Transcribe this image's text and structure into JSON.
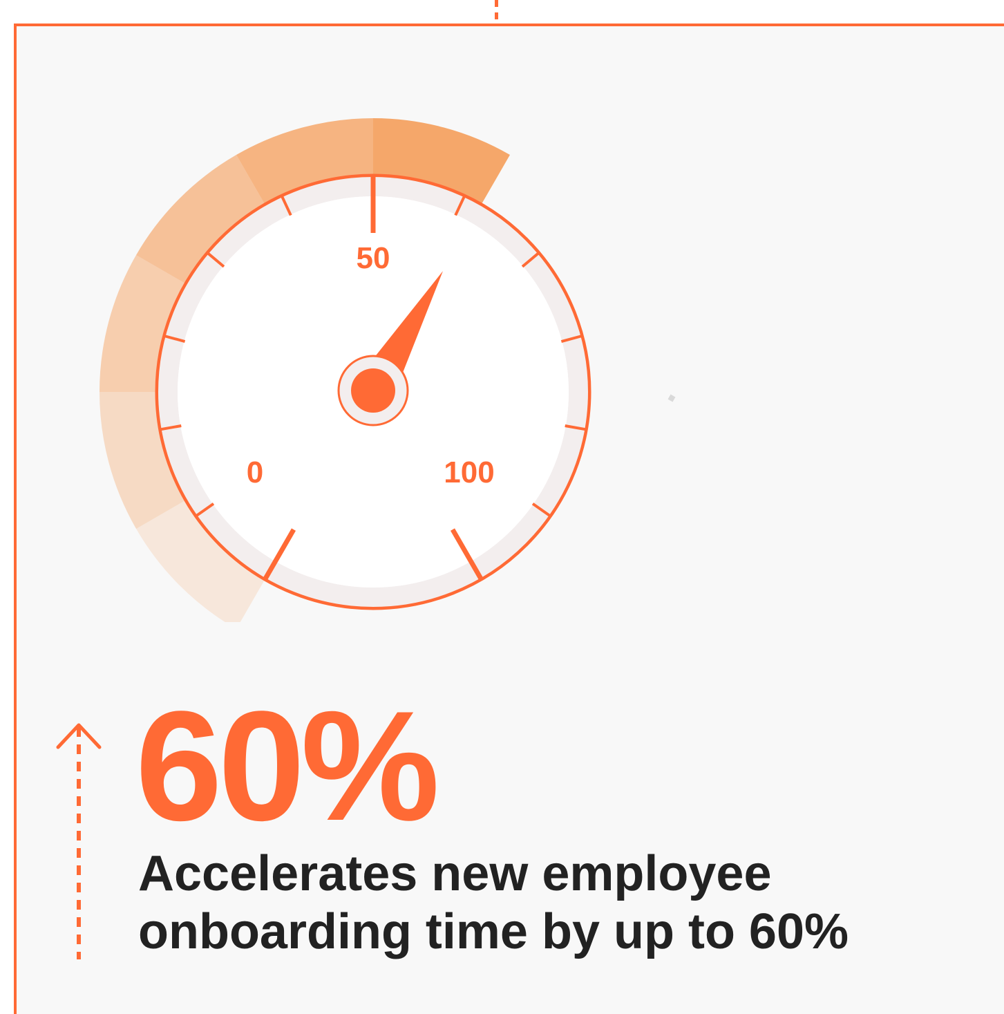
{
  "gauge": {
    "labels": {
      "min": "0",
      "mid": "50",
      "max": "100"
    },
    "value": 60,
    "scale_min": 0,
    "scale_max": 100,
    "colors": {
      "accent": "#ff6a35",
      "track": "#f3eeee",
      "face": "#ffffff",
      "band": "#f5a76a"
    }
  },
  "stat": {
    "value": "60%",
    "description": "Accelerates new employee onboarding time by up to 60%"
  }
}
